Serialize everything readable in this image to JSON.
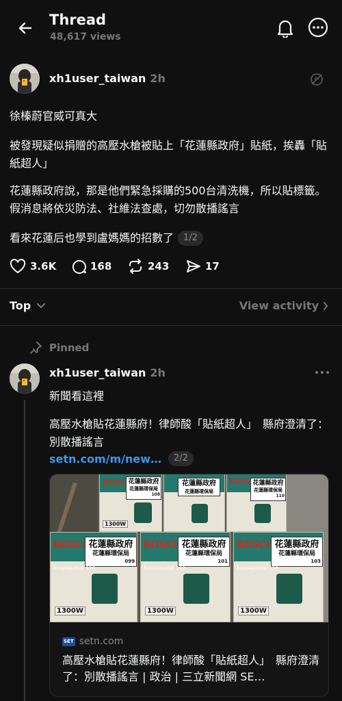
{
  "header": {
    "title": "Thread",
    "views": "48,617 views"
  },
  "post": {
    "username": "xh1user_taiwan",
    "time": "2h",
    "paragraphs": [
      "徐榛蔚官威可真大",
      "被發現疑似捐贈的高壓水槍被貼上「花蓮縣政府」貼紙，挨轟「貼紙超人」",
      "花蓮縣政府說，那是他們緊急採購的500台清洗機，所以貼標籤。假消息將依災防法、社維法查處，切勿散播謠言",
      "看來花蓮后也學到盧媽媽的招數了"
    ],
    "page_indicator": "1/2",
    "actions": {
      "likes": "3.6K",
      "comments": "168",
      "reposts": "243",
      "shares": "17"
    }
  },
  "sort_bar": {
    "sort_label": "Top",
    "view_activity": "View activity"
  },
  "reply": {
    "pinned_label": "Pinned",
    "username": "xh1user_taiwan",
    "time": "2h",
    "text": "新聞看這裡",
    "headline": "高壓水槍貼花蓮縣府！律師酸「貼紙超人」　縣府澄清了：別散播謠言",
    "link": "setn.com/m/new…",
    "page_indicator": "2/2",
    "card": {
      "source_badge": "SET",
      "domain": "setn.com",
      "title": "高壓水槍貼花蓮縣府！律師酸「貼紙超人」　縣府澄清了：別散播謠言 | 政治 | 三立新聞網 SE…",
      "image": {
        "brand": "BOSCH",
        "sticker_line1": "花蓮縣政府",
        "sticker_line2": "花蓮縣環保局",
        "product": "EasyAquatak 110",
        "wattage": "1300W",
        "box_numbers": [
          "108",
          "110",
          "099",
          "101",
          "103"
        ]
      }
    }
  },
  "colors": {
    "background": "#101010",
    "text": "#f3f5f7",
    "muted": "#777777",
    "link": "#3897f0",
    "box_green": "#23796b",
    "brand_red": "#d0281f"
  }
}
